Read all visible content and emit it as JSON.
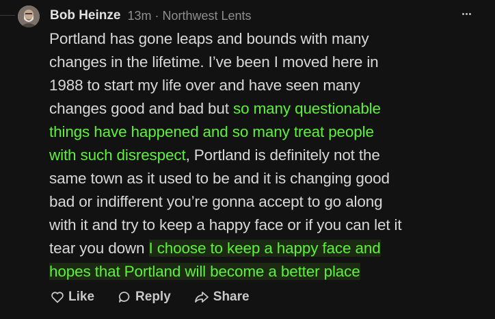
{
  "comment": {
    "author": "Bob Heinze",
    "time": "13m",
    "separator": "·",
    "community": "Northwest Lents",
    "avatar_icon": "avatar-photo",
    "more_icon": "ellipsis-icon",
    "highlight_color": "#5df23a",
    "lines": [
      [
        {
          "text": "Portland has gone leaps and bounds with many",
          "style": "normal"
        }
      ],
      [
        {
          "text": "changes in the lifetime. I’ve been I moved here in",
          "style": "normal"
        }
      ],
      [
        {
          "text": "1988 to start my life over and have seen many",
          "style": "normal"
        }
      ],
      [
        {
          "text": "changes good and bad but ",
          "style": "normal"
        },
        {
          "text": "so many questionable",
          "style": "highlight"
        }
      ],
      [
        {
          "text": "things have happened and so many treat people",
          "style": "highlight"
        }
      ],
      [
        {
          "text": "with such disrespect",
          "style": "highlight"
        },
        {
          "text": ", Portland is definitely not the",
          "style": "normal"
        }
      ],
      [
        {
          "text": "same town as it used to be and it is changing good",
          "style": "normal"
        }
      ],
      [
        {
          "text": "bad or indifferent you’re gonna accept to go along",
          "style": "normal"
        }
      ],
      [
        {
          "text": "with it and try to keep a happy face or if you can let it",
          "style": "normal"
        }
      ],
      [
        {
          "text": "tear you down ",
          "style": "normal"
        },
        {
          "text": "I choose to keep a happy face and",
          "style": "highlight-bg"
        }
      ],
      [
        {
          "text": "hopes that Portland will become a better place",
          "style": "highlight-bg"
        }
      ]
    ]
  },
  "actions": {
    "like_label": "Like",
    "like_icon": "heart-icon",
    "reply_label": "Reply",
    "reply_icon": "speech-bubble-icon",
    "share_label": "Share",
    "share_icon": "share-arrow-icon"
  }
}
